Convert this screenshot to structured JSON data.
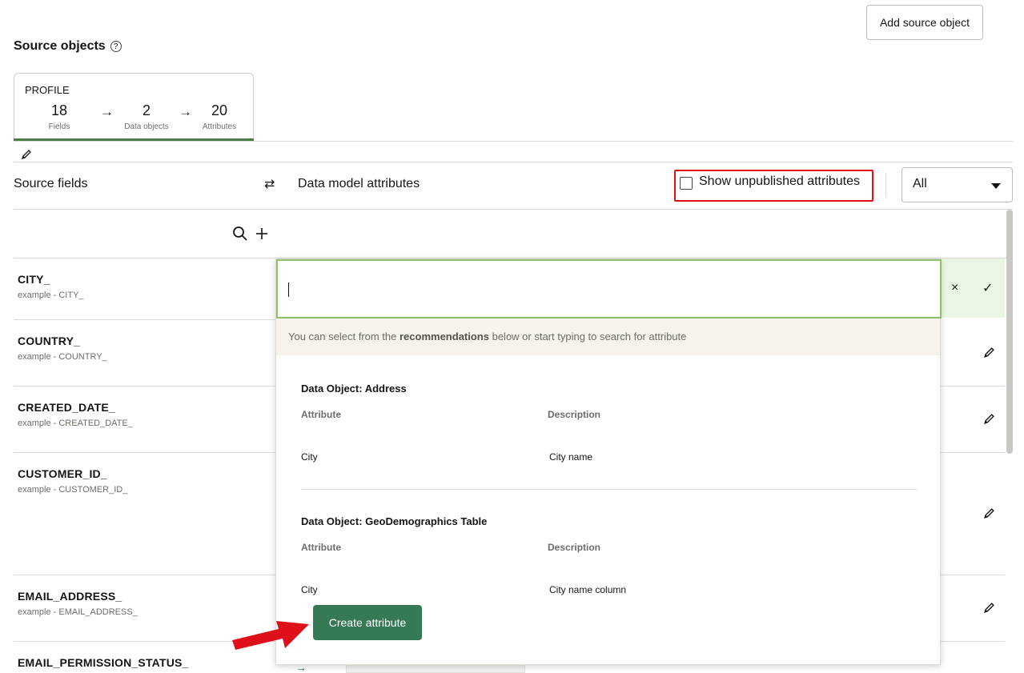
{
  "header": {
    "add_source_label": "Add source object",
    "section_title": "Source objects",
    "help_glyph": "?"
  },
  "profile": {
    "label": "PROFILE",
    "stats": [
      {
        "num": "18",
        "cap": "Fields"
      },
      {
        "num": "2",
        "cap": "Data objects"
      },
      {
        "num": "20",
        "cap": "Attributes"
      }
    ],
    "arrow": "→",
    "accent_color": "#4f7d4a"
  },
  "mapping": {
    "source_fields_label": "Source fields",
    "swap_glyph": "⇄",
    "data_model_label": "Data model attributes",
    "unpublished_label": "Show unpublished attributes",
    "unpublished_checked": false,
    "filter_value": "All",
    "highlight_color": "#e0101a"
  },
  "rows": [
    {
      "title": "CITY_",
      "sub": "example - CITY_"
    },
    {
      "title": "COUNTRY_",
      "sub": "example - COUNTRY_"
    },
    {
      "title": "CREATED_DATE_",
      "sub": "example - CREATED_DATE_"
    },
    {
      "title": "CUSTOMER_ID_",
      "sub": "example - CUSTOMER_ID_"
    },
    {
      "title": "EMAIL_ADDRESS_",
      "sub": "example - EMAIL_ADDRESS_"
    },
    {
      "title": "EMAIL_PERMISSION_STATUS_",
      "sub": ""
    }
  ],
  "edit_row": {
    "cancel_glyph": "×",
    "confirm_glyph": "✓"
  },
  "dropdown": {
    "hint_prefix": "You can select from the ",
    "hint_bold": "recommendations",
    "hint_suffix": " below or start typing to search for attribute",
    "groups": [
      {
        "title": "Data Object: Address",
        "col_attr": "Attribute",
        "col_desc": "Description",
        "attr": "City",
        "desc": "City name"
      },
      {
        "title": "Data Object: GeoDemographics Table",
        "col_attr": "Attribute",
        "col_desc": "Description",
        "attr": "City",
        "desc": "City name column"
      }
    ],
    "create_label": "Create attribute",
    "create_color": "#357a55"
  }
}
